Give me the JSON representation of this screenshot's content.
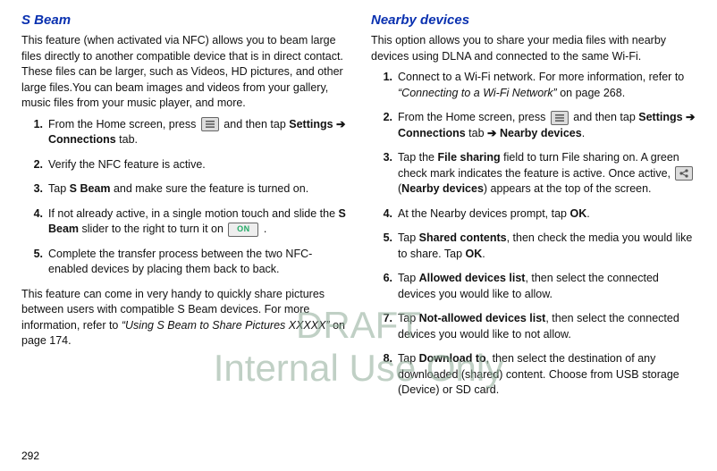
{
  "left": {
    "heading": "S Beam",
    "intro": "This feature (when activated via NFC) allows you to beam large files directly to another compatible device that is in direct contact. These files can be larger, such as Videos, HD pictures, and other large files.You can beam images and videos from your gallery, music files from your music player, and more.",
    "steps": [
      {
        "n": "1.",
        "pre": "From the Home screen, press ",
        "icon": "menu",
        "mid": " and then tap ",
        "b1": "Settings",
        "arr": " ➔ ",
        "b2": "Connections",
        "post": " tab."
      },
      {
        "n": "2.",
        "text": "Verify the NFC feature is active."
      },
      {
        "n": "3.",
        "pre": "Tap ",
        "b1": "S Beam",
        "post": " and make sure the feature is turned on."
      },
      {
        "n": "4.",
        "pre": "If not already active, in a single motion touch and slide the ",
        "b1": "S Beam",
        "mid": " slider to the right to turn it on  ",
        "icon": "on",
        "post": " ."
      },
      {
        "n": "5.",
        "text": "Complete the transfer process between the two NFC-enabled devices by placing them back to back."
      }
    ],
    "outro_pre": "This feature can come in very handy to quickly share pictures between users with compatible S Beam devices. For more information, refer to ",
    "outro_ref": "“Using S Beam to Share Pictures XXXXX”",
    "outro_post": "  on page 174."
  },
  "right": {
    "heading": "Nearby devices",
    "intro": "This option allows you to share your media files with nearby devices using DLNA and connected to the same Wi-Fi.",
    "steps": [
      {
        "n": "1.",
        "pre": "Connect to a Wi-Fi network. For more information, refer to ",
        "ref": "“Connecting to a Wi-Fi Network”",
        "post": "  on page 268."
      },
      {
        "n": "2.",
        "pre": "From the Home screen, press ",
        "icon": "menu",
        "mid": " and then tap ",
        "b1": "Settings",
        "arr": " ➔ ",
        "b2": "Connections",
        "mid2": " tab ",
        "arr2": "➔ ",
        "b3": "Nearby devices",
        "post": "."
      },
      {
        "n": "3.",
        "pre": "Tap the ",
        "b1": "File sharing",
        "mid": " field to turn File sharing on. A green check mark indicates the feature is active. Once active, ",
        "icon": "share",
        "mid2": " (",
        "b2": "Nearby devices",
        "post": ") appears at the top of the screen."
      },
      {
        "n": "4.",
        "pre": "At the Nearby devices prompt, tap ",
        "b1": "OK",
        "post": "."
      },
      {
        "n": "5.",
        "pre": "Tap ",
        "b1": "Shared contents",
        "mid": ", then check the media you would like to share. Tap ",
        "b2": "OK",
        "post": "."
      },
      {
        "n": "6.",
        "pre": "Tap ",
        "b1": "Allowed devices list",
        "post": ", then select the connected devices you would like to allow."
      },
      {
        "n": "7.",
        "pre": "Tap ",
        "b1": "Not-allowed devices list",
        "post": ", then select the connected devices you would like to not allow."
      },
      {
        "n": "8.",
        "pre": "Tap ",
        "b1": "Download to",
        "post": ", then select the destination of any downloaded (shared) content. Choose from USB storage (Device) or SD card."
      }
    ]
  },
  "watermark_l1": "DRAFT",
  "watermark_l2": "Internal Use Only",
  "pagenum": "292",
  "icons": {
    "on_label": "ON"
  }
}
